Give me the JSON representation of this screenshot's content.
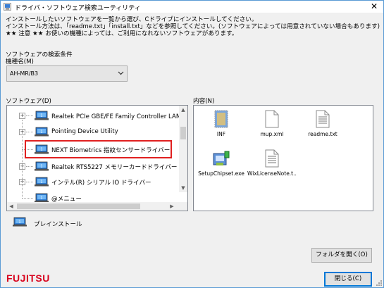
{
  "window": {
    "title": "ドライバ・ソフトウェア検索ユーティリティ",
    "close_glyph": "✕"
  },
  "description": {
    "line1": "インストールしたいソフトウェアを一覧から選び、Cドライブにインストールしてください。",
    "line2": "インストール方法は、「readme.txt」「install.txt」などを参照してください。(ソフトウェアによっては用意されていない場合もあります)",
    "line3": "★★ 注意 ★★ お使いの機種によっては、ご利用になれないソフトウェアがあります。"
  },
  "search": {
    "section_label": "ソフトウェアの検索条件",
    "model_label": "機種名(M)",
    "model_value": "AH-MR/B3"
  },
  "software": {
    "label": "ソフトウェア(D)",
    "items": [
      {
        "label": "Realtek PCIe GBE/FE Family Controller LAN ドラ",
        "expandable": true
      },
      {
        "label": "Pointing Device Utility",
        "expandable": true
      },
      {
        "label": "NEXT Biometrics 指紋センサードライバー",
        "expandable": false,
        "highlighted": true
      },
      {
        "label": "Realtek RTS5227 メモリーカードドライバー",
        "expandable": true
      },
      {
        "label": "インテル(R) シリアル IO ドライバー",
        "expandable": true
      },
      {
        "label": "@メニュー",
        "expandable": false
      }
    ]
  },
  "contents": {
    "label": "内容(N)",
    "files": [
      {
        "name": "INF",
        "icon": "folder-icon"
      },
      {
        "name": "mup.xml",
        "icon": "document-icon"
      },
      {
        "name": "readme.txt",
        "icon": "text-file-icon"
      },
      {
        "name": "SetupChipset.exe",
        "icon": "installer-icon"
      },
      {
        "name": "WixLicenseNote.t...",
        "icon": "text-file-icon"
      }
    ]
  },
  "preinstall": {
    "label": "プレインストール"
  },
  "buttons": {
    "open_folder": "フォルダを開く(O)",
    "close": "閉じる(C)"
  },
  "brand": {
    "logo_text": "FUJITSU",
    "color": "#d8001c"
  },
  "colors": {
    "highlight_box": "#e02020",
    "selection_accent": "#0078d7"
  }
}
